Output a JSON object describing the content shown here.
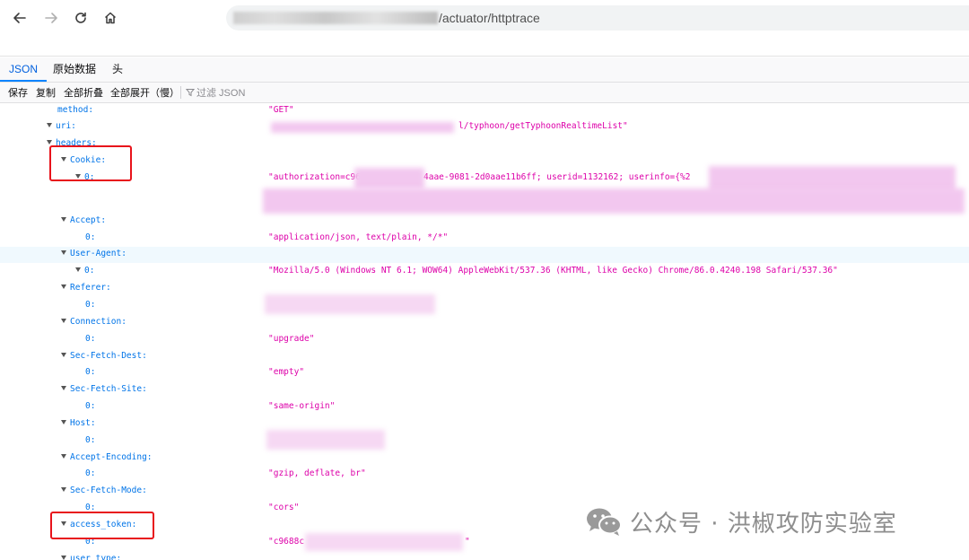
{
  "browser": {
    "url_visible_suffix": "/actuator/httptrace"
  },
  "viewer": {
    "tabs": [
      {
        "label": "JSON",
        "active": true
      },
      {
        "label": "原始数据",
        "active": false
      },
      {
        "label": "头",
        "active": false
      }
    ],
    "actions": [
      "保存",
      "复制",
      "全部折叠",
      "全部展开（慢）"
    ],
    "filter_placeholder": "过滤 JSON"
  },
  "tree": {
    "method": {
      "key": "method:",
      "value": "\"GET\""
    },
    "uri": {
      "key": "uri:",
      "value_suffix": "l/typhoon/getTyphoonRealtimeList\""
    },
    "headers": {
      "key": "headers:"
    },
    "cookie": {
      "key": "Cookie:",
      "idx": "0:",
      "value_visible": "\"authorization=c96",
      "value_mid": "4aae-9081-2d0aae11b6ff; userid=1132162; userinfo={%2"
    },
    "accept": {
      "key": "Accept:",
      "idx": "0:",
      "value": "\"application/json, text/plain, */*\""
    },
    "user_agent": {
      "key": "User-Agent:",
      "idx": "0:",
      "value": "\"Mozilla/5.0 (Windows NT 6.1; WOW64) AppleWebKit/537.36 (KHTML, like Gecko) Chrome/86.0.4240.198 Safari/537.36\""
    },
    "referer": {
      "key": "Referer:",
      "idx": "0:"
    },
    "connection": {
      "key": "Connection:",
      "idx": "0:",
      "value": "\"upgrade\""
    },
    "sec_fetch_dest": {
      "key": "Sec-Fetch-Dest:",
      "idx": "0:",
      "value": "\"empty\""
    },
    "sec_fetch_site": {
      "key": "Sec-Fetch-Site:",
      "idx": "0:",
      "value": "\"same-origin\""
    },
    "host": {
      "key": "Host:",
      "idx": "0:"
    },
    "accept_encoding": {
      "key": "Accept-Encoding:",
      "idx": "0:",
      "value": "\"gzip, deflate, br\""
    },
    "sec_fetch_mode": {
      "key": "Sec-Fetch-Mode:",
      "idx": "0:",
      "value": "\"cors\""
    },
    "access_token": {
      "key": "access_token:",
      "idx": "0:",
      "value_prefix": "\"c9688c",
      "value_suffix": "\""
    },
    "user_type": {
      "key": "user_type:"
    }
  },
  "watermark": {
    "text": "公众号 · 洪椒攻防实验室"
  },
  "colors": {
    "key": "#0074e8",
    "string": "#dd00a9",
    "highlight_box": "#e8131b",
    "redaction": "#f2c7ef"
  }
}
